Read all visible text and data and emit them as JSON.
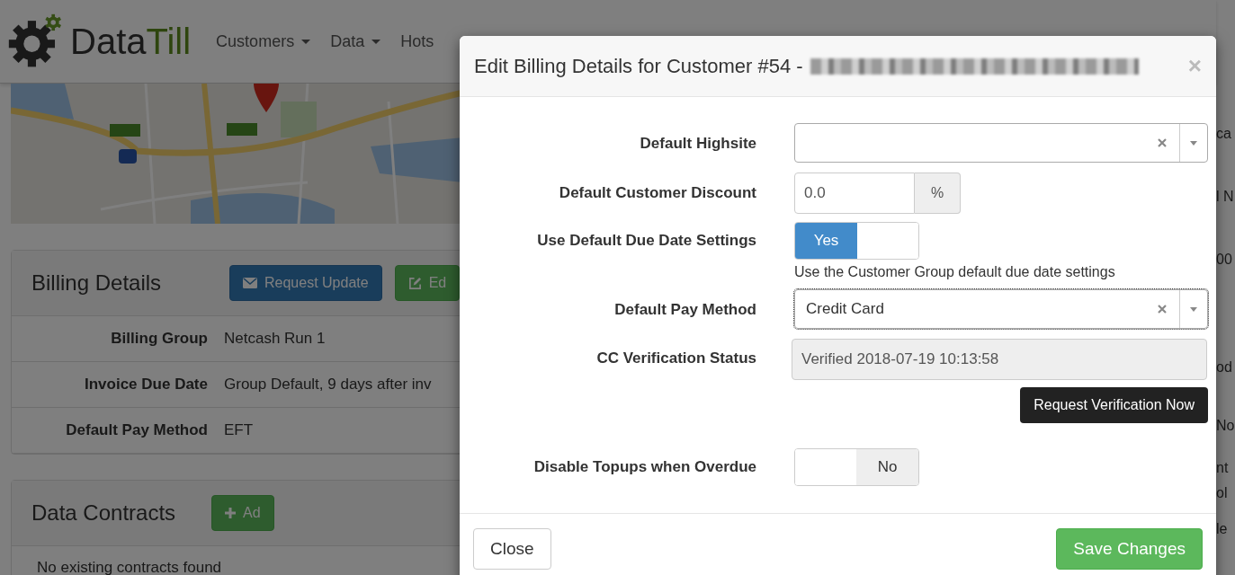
{
  "navbar": {
    "brand_prefix": "Data",
    "brand_suffix": "Till",
    "menu": [
      {
        "label": "Customers",
        "dropdown": true
      },
      {
        "label": "Data",
        "dropdown": true
      },
      {
        "label": "Hots",
        "dropdown": false
      }
    ]
  },
  "billing_panel": {
    "title": "Billing Details",
    "buttons": [
      {
        "label": "Request Update",
        "kind": "primary"
      },
      {
        "label": "Ed",
        "kind": "success"
      }
    ],
    "rows": [
      {
        "label": "Billing Group",
        "value": "Netcash Run 1"
      },
      {
        "label": "Invoice Due Date",
        "value": "Group Default, 9 days after inv"
      },
      {
        "label": "Default Pay Method",
        "value": "EFT"
      }
    ]
  },
  "contracts_panel": {
    "title": "Data Contracts",
    "button": {
      "label": "Ad",
      "kind": "success"
    },
    "empty_text": "No existing contracts found"
  },
  "right_fragments": [
    "ca",
    "l N",
    "00",
    "od",
    "No",
    "nt",
    "ol",
    "le"
  ],
  "modal": {
    "title": "Edit Billing Details for Customer #54 -",
    "close": "×",
    "fields": [
      {
        "kind": "select",
        "label": "Default Highsite"
      },
      {
        "kind": "addon",
        "label": "Default Customer Discount",
        "value": "0.0",
        "addon": "%"
      },
      {
        "kind": "toggle",
        "label": "Use Default Due Date Settings",
        "on": true,
        "text": "Yes",
        "help": "Use the Customer Group default due date settings"
      },
      {
        "kind": "select",
        "label": "Default Pay Method",
        "value": "Credit Card"
      },
      {
        "kind": "readonly",
        "label": "CC Verification Status",
        "value": "Verified 2018-07-19 10:13:58",
        "action": "Request Verification Now"
      },
      {
        "kind": "toggle",
        "label": "Disable Topups when Overdue",
        "on": false,
        "text": "No"
      }
    ],
    "footer_buttons": [
      {
        "label": "Close",
        "kind": "default"
      },
      {
        "label": "Save Changes",
        "kind": "success"
      }
    ]
  }
}
